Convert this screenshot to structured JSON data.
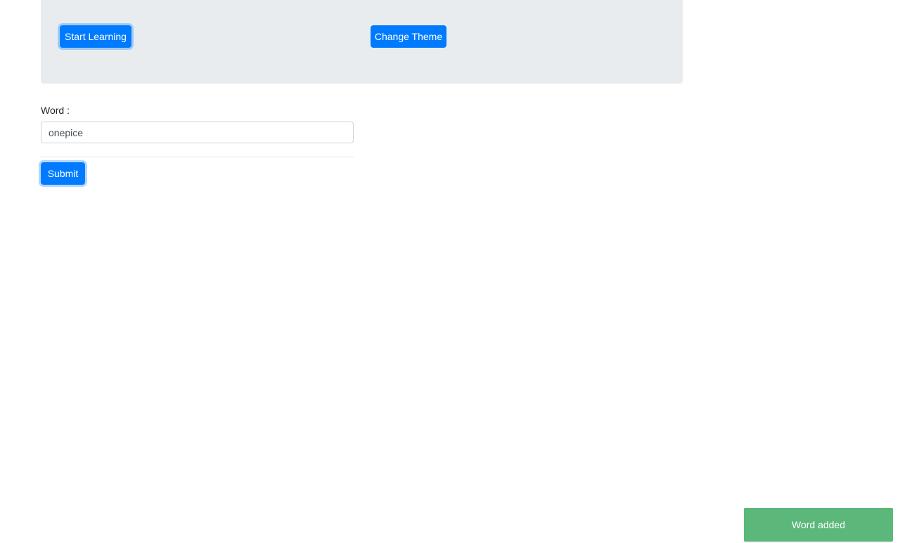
{
  "hero": {
    "start_learning_label": "Start Learning",
    "change_theme_label": "Change Theme",
    "background_color": "#e9ecef"
  },
  "form": {
    "word_label": "Word :",
    "word_value": "onepice",
    "word_placeholder": "",
    "submit_label": "Submit"
  },
  "toast": {
    "message": "Word added",
    "background_color": "#5cb87a",
    "text_color": "#ffffff"
  },
  "theme": {
    "primary_color": "#007bff",
    "page_background": "#ffffff",
    "input_border_color": "#ced4da",
    "divider_color": "#e6e6e6"
  }
}
